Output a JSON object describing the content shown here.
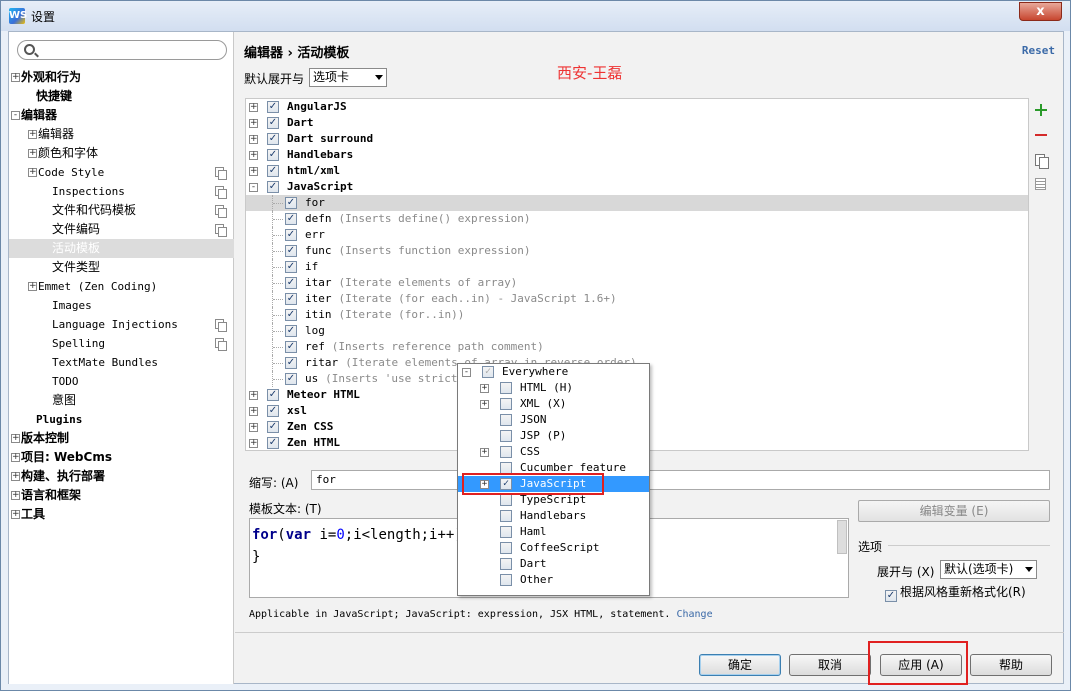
{
  "window": {
    "title": "设置",
    "logo": "WS",
    "close": "x"
  },
  "search": {
    "placeholder": ""
  },
  "nav": [
    {
      "label": "外观和行为",
      "pm": "+",
      "indent": 12,
      "bold": true,
      "mono": false,
      "sel": false,
      "copy": false
    },
    {
      "label": "快捷键",
      "pm": "",
      "indent": 27,
      "bold": true,
      "mono": false,
      "sel": false,
      "copy": false
    },
    {
      "label": "编辑器",
      "pm": "-",
      "indent": 12,
      "bold": true,
      "mono": false,
      "sel": false,
      "copy": false
    },
    {
      "label": "编辑器",
      "pm": "+",
      "indent": 29,
      "bold": false,
      "mono": false,
      "sel": false,
      "copy": false
    },
    {
      "label": "颜色和字体",
      "pm": "+",
      "indent": 29,
      "bold": false,
      "mono": false,
      "sel": false,
      "copy": false
    },
    {
      "label": "Code Style",
      "pm": "+",
      "indent": 29,
      "bold": false,
      "mono": true,
      "sel": false,
      "copy": true
    },
    {
      "label": "Inspections",
      "pm": "",
      "indent": 43,
      "bold": false,
      "mono": true,
      "sel": false,
      "copy": true
    },
    {
      "label": "文件和代码模板",
      "pm": "",
      "indent": 43,
      "bold": false,
      "mono": false,
      "sel": false,
      "copy": true
    },
    {
      "label": "文件编码",
      "pm": "",
      "indent": 43,
      "bold": false,
      "mono": false,
      "sel": false,
      "copy": true
    },
    {
      "label": "活动模板",
      "pm": "",
      "indent": 43,
      "bold": false,
      "mono": false,
      "sel": true,
      "copy": false
    },
    {
      "label": "文件类型",
      "pm": "",
      "indent": 43,
      "bold": false,
      "mono": false,
      "sel": false,
      "copy": false
    },
    {
      "label": "Emmet (Zen Coding)",
      "pm": "+",
      "indent": 29,
      "bold": false,
      "mono": true,
      "sel": false,
      "copy": false
    },
    {
      "label": "Images",
      "pm": "",
      "indent": 43,
      "bold": false,
      "mono": true,
      "sel": false,
      "copy": false
    },
    {
      "label": "Language Injections",
      "pm": "",
      "indent": 43,
      "bold": false,
      "mono": true,
      "sel": false,
      "copy": true
    },
    {
      "label": "Spelling",
      "pm": "",
      "indent": 43,
      "bold": false,
      "mono": true,
      "sel": false,
      "copy": true
    },
    {
      "label": "TextMate Bundles",
      "pm": "",
      "indent": 43,
      "bold": false,
      "mono": true,
      "sel": false,
      "copy": false
    },
    {
      "label": "TODO",
      "pm": "",
      "indent": 43,
      "bold": false,
      "mono": true,
      "sel": false,
      "copy": false
    },
    {
      "label": "意图",
      "pm": "",
      "indent": 43,
      "bold": false,
      "mono": false,
      "sel": false,
      "copy": false
    },
    {
      "label": "Plugins",
      "pm": "",
      "indent": 27,
      "bold": true,
      "mono": true,
      "sel": false,
      "copy": false
    },
    {
      "label": "版本控制",
      "pm": "+",
      "indent": 12,
      "bold": true,
      "mono": false,
      "sel": false,
      "copy": false
    },
    {
      "label": "项目: WebCms",
      "pm": "+",
      "indent": 12,
      "bold": true,
      "mono": false,
      "sel": false,
      "copy": false
    },
    {
      "label": "构建、执行部署",
      "pm": "+",
      "indent": 12,
      "bold": true,
      "mono": false,
      "sel": false,
      "copy": false
    },
    {
      "label": "语言和框架",
      "pm": "+",
      "indent": 12,
      "bold": true,
      "mono": false,
      "sel": false,
      "copy": false
    },
    {
      "label": "工具",
      "pm": "+",
      "indent": 12,
      "bold": true,
      "mono": false,
      "sel": false,
      "copy": false
    }
  ],
  "header": {
    "breadcrumb": "编辑器 › 活动模板",
    "reset": "Reset"
  },
  "expand": {
    "label": "默认展开与",
    "value": "选项卡"
  },
  "watermark": "西安-王磊",
  "tree": [
    {
      "name": "AngularJS",
      "desc": "",
      "level": 0,
      "pm": "+",
      "checked": true,
      "sel": false
    },
    {
      "name": "Dart",
      "desc": "",
      "level": 0,
      "pm": "+",
      "checked": true,
      "sel": false
    },
    {
      "name": "Dart surround",
      "desc": "",
      "level": 0,
      "pm": "+",
      "checked": true,
      "sel": false
    },
    {
      "name": "Handlebars",
      "desc": "",
      "level": 0,
      "pm": "+",
      "checked": true,
      "sel": false
    },
    {
      "name": "html/xml",
      "desc": "",
      "level": 0,
      "pm": "+",
      "checked": true,
      "sel": false
    },
    {
      "name": "JavaScript",
      "desc": "",
      "level": 0,
      "pm": "-",
      "checked": true,
      "sel": false
    },
    {
      "name": "for",
      "desc": "",
      "level": 1,
      "pm": "",
      "checked": true,
      "sel": true
    },
    {
      "name": "defn",
      "desc": "(Inserts define() expression)",
      "level": 1,
      "pm": "",
      "checked": true,
      "sel": false
    },
    {
      "name": "err",
      "desc": "",
      "level": 1,
      "pm": "",
      "checked": true,
      "sel": false
    },
    {
      "name": "func",
      "desc": "(Inserts function expression)",
      "level": 1,
      "pm": "",
      "checked": true,
      "sel": false
    },
    {
      "name": "if",
      "desc": "",
      "level": 1,
      "pm": "",
      "checked": true,
      "sel": false
    },
    {
      "name": "itar",
      "desc": "(Iterate elements of array)",
      "level": 1,
      "pm": "",
      "checked": true,
      "sel": false
    },
    {
      "name": "iter",
      "desc": "(Iterate (for each..in) - JavaScript 1.6+)",
      "level": 1,
      "pm": "",
      "checked": true,
      "sel": false
    },
    {
      "name": "itin",
      "desc": "(Iterate (for..in))",
      "level": 1,
      "pm": "",
      "checked": true,
      "sel": false
    },
    {
      "name": "log",
      "desc": "",
      "level": 1,
      "pm": "",
      "checked": true,
      "sel": false
    },
    {
      "name": "ref",
      "desc": "(Inserts reference path comment)",
      "level": 1,
      "pm": "",
      "checked": true,
      "sel": false
    },
    {
      "name": "ritar",
      "desc": "(Iterate elements of array in reverse order)",
      "level": 1,
      "pm": "",
      "checked": true,
      "sel": false
    },
    {
      "name": "us",
      "desc": "(Inserts 'use strict'",
      "level": 1,
      "pm": "",
      "checked": true,
      "sel": false
    },
    {
      "name": "Meteor HTML",
      "desc": "",
      "level": 0,
      "pm": "+",
      "checked": true,
      "sel": false
    },
    {
      "name": "xsl",
      "desc": "",
      "level": 0,
      "pm": "+",
      "checked": true,
      "sel": false
    },
    {
      "name": "Zen CSS",
      "desc": "",
      "level": 0,
      "pm": "+",
      "checked": true,
      "sel": false
    },
    {
      "name": "Zen HTML",
      "desc": "",
      "level": 0,
      "pm": "+",
      "checked": true,
      "sel": false
    }
  ],
  "abbr": {
    "label": "缩写: (A)",
    "value": "for"
  },
  "template": {
    "label": "模板文本: (T)",
    "line1_kw1": "for",
    "line1_a": "(",
    "line1_kw2": "var",
    "line1_b": " i=",
    "line1_n1": "0",
    "line1_c": ";i<length;i++)",
    "line2": "}"
  },
  "editvar": "编辑变量 (E)",
  "options": {
    "label": "选项",
    "expand_label": "展开与 (X)",
    "expand_value": "默认(选项卡)",
    "reformat_label": "根据风格重新格式化(R)",
    "reformat_checked": true
  },
  "applicable": {
    "text": "Applicable in JavaScript; JavaScript: expression, JSX HTML, statement.",
    "change": "Change"
  },
  "buttons": {
    "ok": "确定",
    "cancel": "取消",
    "apply": "应用 (A)",
    "help": "帮助"
  },
  "popup": [
    {
      "name": "Everywhere",
      "level": 0,
      "pm": "-",
      "checked": true,
      "sel": false,
      "disabled": true
    },
    {
      "name": "HTML (H)",
      "level": 1,
      "pm": "+",
      "checked": false,
      "sel": false
    },
    {
      "name": "XML (X)",
      "level": 1,
      "pm": "+",
      "checked": false,
      "sel": false
    },
    {
      "name": "JSON",
      "level": 1,
      "pm": "",
      "checked": false,
      "sel": false
    },
    {
      "name": "JSP (P)",
      "level": 1,
      "pm": "",
      "checked": false,
      "sel": false
    },
    {
      "name": "CSS",
      "level": 1,
      "pm": "+",
      "checked": false,
      "sel": false
    },
    {
      "name": "Cucumber feature",
      "level": 1,
      "pm": "",
      "checked": false,
      "sel": false
    },
    {
      "name": "JavaScript",
      "level": 1,
      "pm": "+",
      "checked": true,
      "sel": true
    },
    {
      "name": "TypeScript",
      "level": 1,
      "pm": "",
      "checked": false,
      "sel": false
    },
    {
      "name": "Handlebars",
      "level": 1,
      "pm": "",
      "checked": false,
      "sel": false
    },
    {
      "name": "Haml",
      "level": 1,
      "pm": "",
      "checked": false,
      "sel": false
    },
    {
      "name": "CoffeeScript",
      "level": 1,
      "pm": "",
      "checked": false,
      "sel": false
    },
    {
      "name": "Dart",
      "level": 1,
      "pm": "",
      "checked": false,
      "sel": false
    },
    {
      "name": "Other",
      "level": 1,
      "pm": "",
      "checked": false,
      "sel": false
    }
  ]
}
